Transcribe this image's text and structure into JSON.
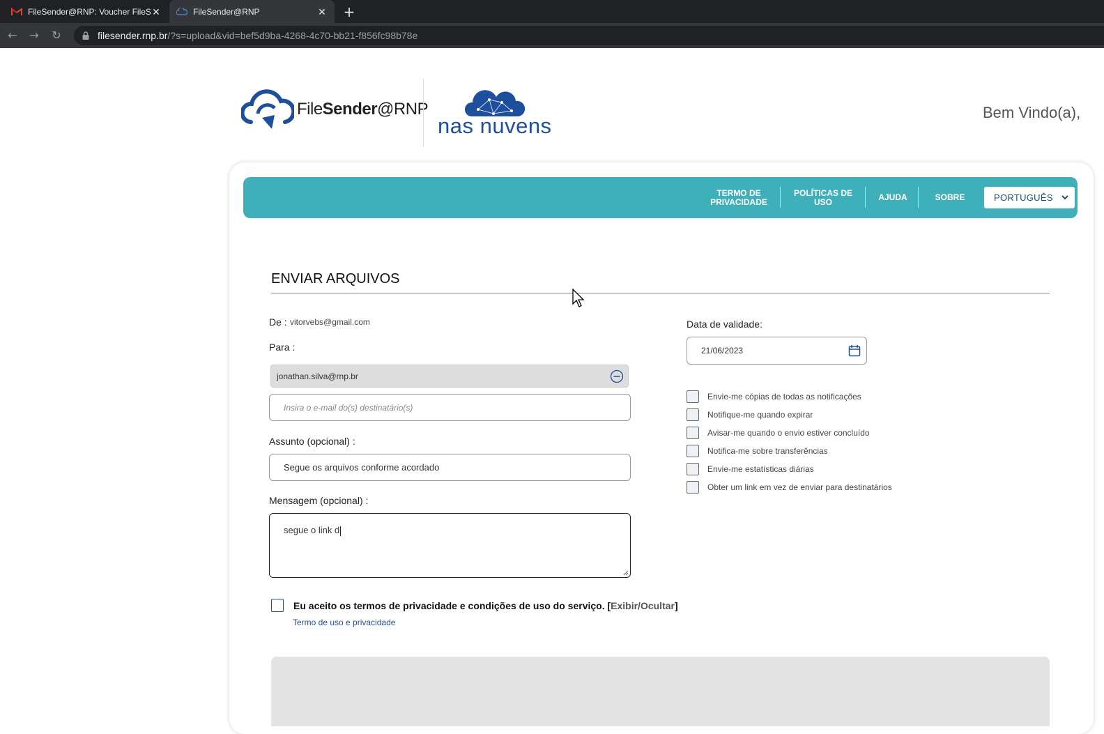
{
  "browser": {
    "tabs": [
      {
        "title": "FileSender@RNP: Voucher FileSe",
        "active": false,
        "icon": "gmail-icon"
      },
      {
        "title": "FileSender@RNP",
        "active": true,
        "icon": "filesender-favicon-icon"
      }
    ],
    "url_host": "filesender.rnp.br",
    "url_path": "/?s=upload&vid=bef5d9ba-4268-4c70-bb21-f856fc98b78e"
  },
  "header": {
    "logo_fs_light": "File",
    "logo_fs_bold": "Sender",
    "logo_fs_suffix": "@RNP",
    "logo_nn": "nas nuvens",
    "welcome": "Bem Vindo(a),"
  },
  "nav": {
    "items": [
      {
        "line1": "TERMO DE",
        "line2": "PRIVACIDADE"
      },
      {
        "line1": "POLÍTICAS DE",
        "line2": "USO"
      },
      {
        "line1": "AJUDA",
        "line2": ""
      },
      {
        "line1": "SOBRE",
        "line2": ""
      }
    ],
    "language": "PORTUGUÊS",
    "color": "#3fb0b9"
  },
  "form": {
    "title": "ENVIAR ARQUIVOS",
    "from_label": "De :",
    "from_value": "vitorvebs@gmail.com",
    "to_label": "Para :",
    "recipient": "jonathan.silva@rnp.br",
    "recipient_placeholder": "Insira o e-mail do(s) destinatário(s)",
    "subject_label": "Assunto (opcional) :",
    "subject_value": "Segue os arquivos conforme acordado",
    "message_label": "Mensagem (opcional) :",
    "message_value": "segue o link d",
    "expiry_label": "Data de validade:",
    "expiry_value": "21/06/2023",
    "options": [
      "Envie-me cópias de todas as notificações",
      "Notifique-me quando expirar",
      "Avisar-me quando o envio estiver concluído",
      "Notifica-me sobre transferências",
      "Envie-me estatísticas diárias",
      "Obter um link em vez de enviar para destinatários"
    ],
    "terms_text": "Eu aceito os termos de privacidade e condições de uso do serviço.",
    "terms_toggle_open": "[",
    "terms_toggle": "Exibir/Ocultar",
    "terms_toggle_close": "]",
    "terms_link": "Termo de uso e privacidade"
  }
}
